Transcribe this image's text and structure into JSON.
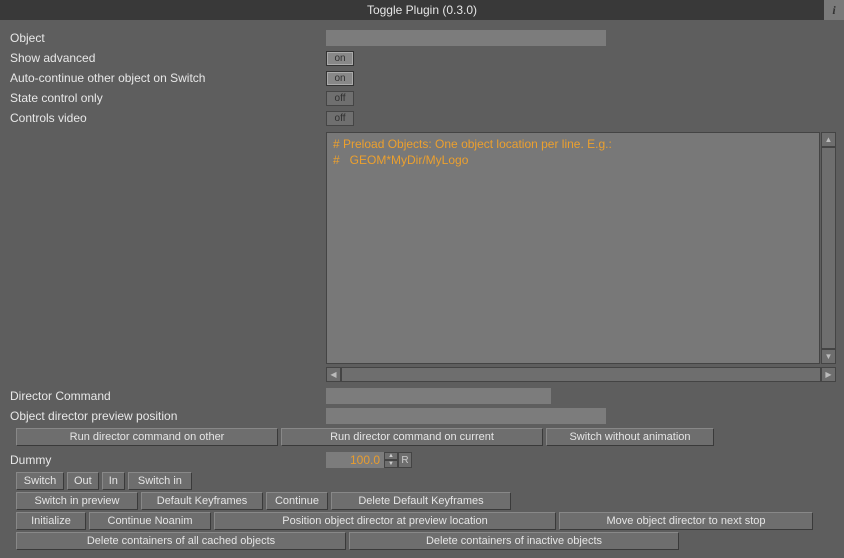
{
  "title": "Toggle Plugin (0.3.0)",
  "info_icon": "i",
  "fields": {
    "object": {
      "label": "Object",
      "value": ""
    },
    "show_advanced": {
      "label": "Show advanced",
      "state": "on"
    },
    "auto_continue": {
      "label": "Auto-continue other object on Switch",
      "state": "on"
    },
    "state_control_only": {
      "label": "State control only",
      "state": "off"
    },
    "controls_video": {
      "label": "Controls video",
      "state": "off"
    },
    "preload_text": "# Preload Objects: One object location per line. E.g.:\n#   GEOM*MyDir/MyLogo",
    "director_command": {
      "label": "Director Command",
      "value": ""
    },
    "obj_dir_preview_pos": {
      "label": "Object director preview position",
      "value": ""
    },
    "dummy": {
      "label": "Dummy",
      "value": "100.0",
      "r": "R"
    }
  },
  "button_row1": {
    "b1": "Run director command on other",
    "b2": "Run director command on current",
    "b3": "Switch without animation"
  },
  "button_row_small": {
    "b1": "Switch",
    "b2": "Out",
    "b3": "In",
    "b4": "Switch in"
  },
  "button_row2": {
    "b1": "Switch in preview",
    "b2": "Default Keyframes",
    "b3": "Continue",
    "b4": "Delete Default Keyframes"
  },
  "button_row3": {
    "b1": "Initialize",
    "b2": "Continue Noanim",
    "b3": "Position object director at preview location",
    "b4": "Move object director to next stop"
  },
  "button_row4": {
    "b1": "Delete containers of all cached objects",
    "b2": "Delete containers of inactive objects"
  }
}
